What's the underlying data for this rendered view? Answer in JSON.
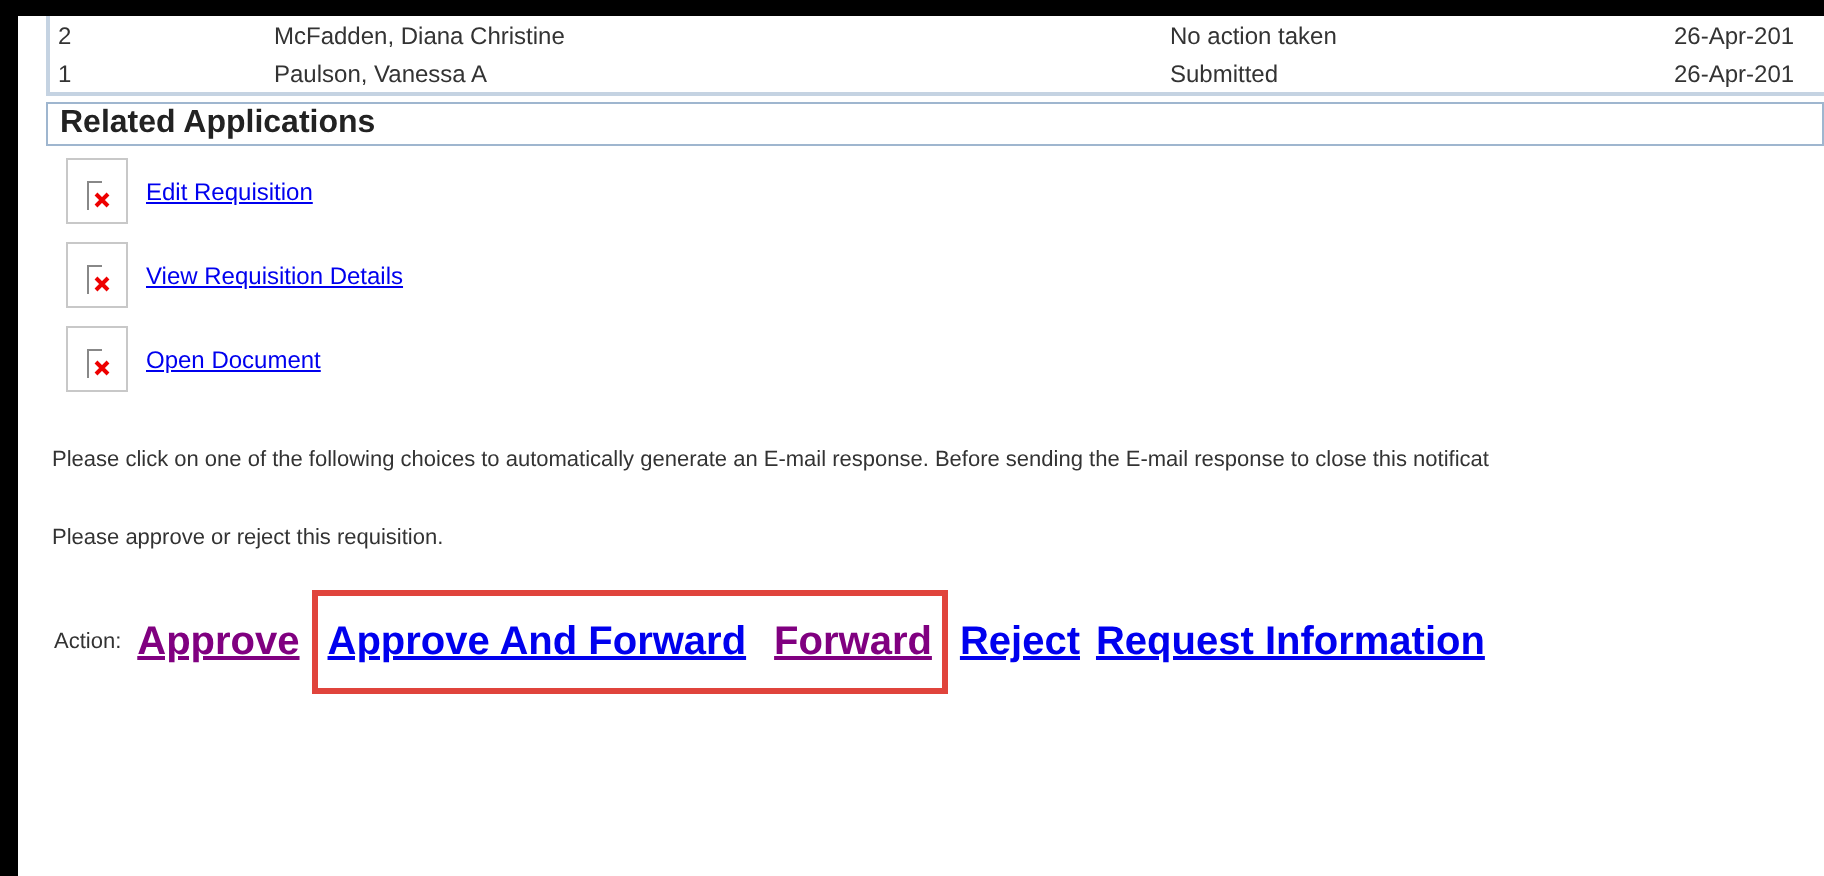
{
  "approvers": {
    "rows": [
      {
        "number": "2",
        "name": "McFadden, Diana Christine",
        "action": "No action taken",
        "date": "26-Apr-201"
      },
      {
        "number": "1",
        "name": "Paulson, Vanessa A",
        "action": "Submitted",
        "date": "26-Apr-201"
      }
    ]
  },
  "related_applications": {
    "title": "Related Applications",
    "links": [
      "Edit Requisition",
      "View Requisition Details",
      "Open Document"
    ]
  },
  "instructions": [
    "Please click on one of the following choices to automatically generate an E-mail response. Before sending the E-mail response to close this notificat",
    "Please approve or reject this requisition."
  ],
  "actions": {
    "label": "Action:",
    "links": [
      {
        "text": "Approve",
        "visited": true,
        "highlighted": false
      },
      {
        "text": "Approve And Forward",
        "visited": false,
        "highlighted": true
      },
      {
        "text": "Forward",
        "visited": true,
        "highlighted": true
      },
      {
        "text": "Reject",
        "visited": false,
        "highlighted": false
      },
      {
        "text": "Request Information",
        "visited": false,
        "highlighted": false
      }
    ]
  }
}
